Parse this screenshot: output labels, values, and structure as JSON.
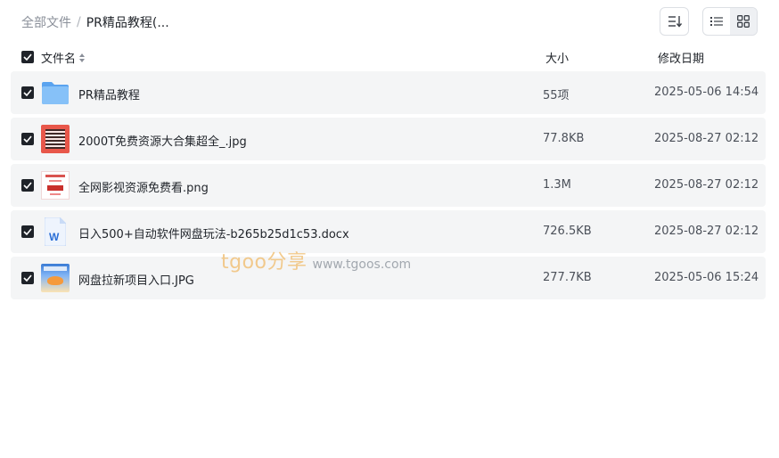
{
  "breadcrumb": {
    "root": "全部文件",
    "separator": "/",
    "current": "PR精品教程(..."
  },
  "toolbar": {
    "sort_icon": "sort-lines-icon",
    "list_view_icon": "list-view-icon",
    "grid_view_icon": "grid-view-icon",
    "active_view": "list"
  },
  "table": {
    "headers": {
      "name": "文件名",
      "size": "大小",
      "date": "修改日期"
    },
    "rows": [
      {
        "name": "PR精品教程",
        "size": "55项",
        "date": "2025-05-06 14:54",
        "icon": "folder-icon"
      },
      {
        "name": "2000T免费资源大合集超全_.jpg",
        "size": "77.8KB",
        "date": "2025-08-27 02:12",
        "icon": "image-thumbnail-qr"
      },
      {
        "name": "全网影视资源免费看.png",
        "size": "1.3M",
        "date": "2025-08-27 02:12",
        "icon": "image-thumbnail-poster"
      },
      {
        "name": "日入500+自动软件网盘玩法-b265b25d1c53.docx",
        "size": "726.5KB",
        "date": "2025-08-27 02:12",
        "icon": "word-doc-icon"
      },
      {
        "name": "网盘拉新项目入口.JPG",
        "size": "277.7KB",
        "date": "2025-05-06 15:24",
        "icon": "image-thumbnail-promo"
      }
    ]
  },
  "watermark": {
    "brand": "tgoo分享",
    "url": "www.tgoos.com"
  },
  "colors": {
    "row_bg": "#f4f5f6",
    "checkbox": "#1f2329",
    "folder": "#6fb2f5",
    "word_blue": "#2b6fd6"
  }
}
